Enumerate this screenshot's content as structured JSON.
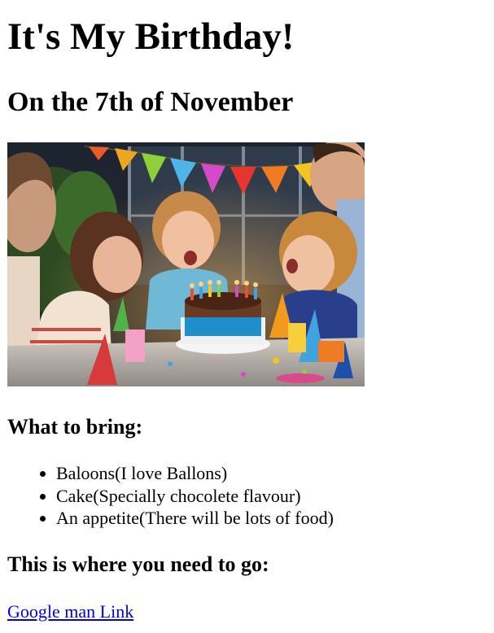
{
  "heading": "It's My Birthday!",
  "subheading": "On the 7th of November",
  "photo": {
    "alt": "Children blowing out candles on a birthday cake at a party"
  },
  "bring": {
    "heading": "What to bring:",
    "items": [
      "Baloons(I love Ballons)",
      "Cake(Specially chocolete flavour)",
      "An appetite(There will be lots of food)"
    ]
  },
  "location": {
    "heading": "This is where you need to go:",
    "link_label": "Google man Link"
  },
  "colors": {
    "link": "#0000ee",
    "text": "#000000",
    "background": "#ffffff"
  }
}
